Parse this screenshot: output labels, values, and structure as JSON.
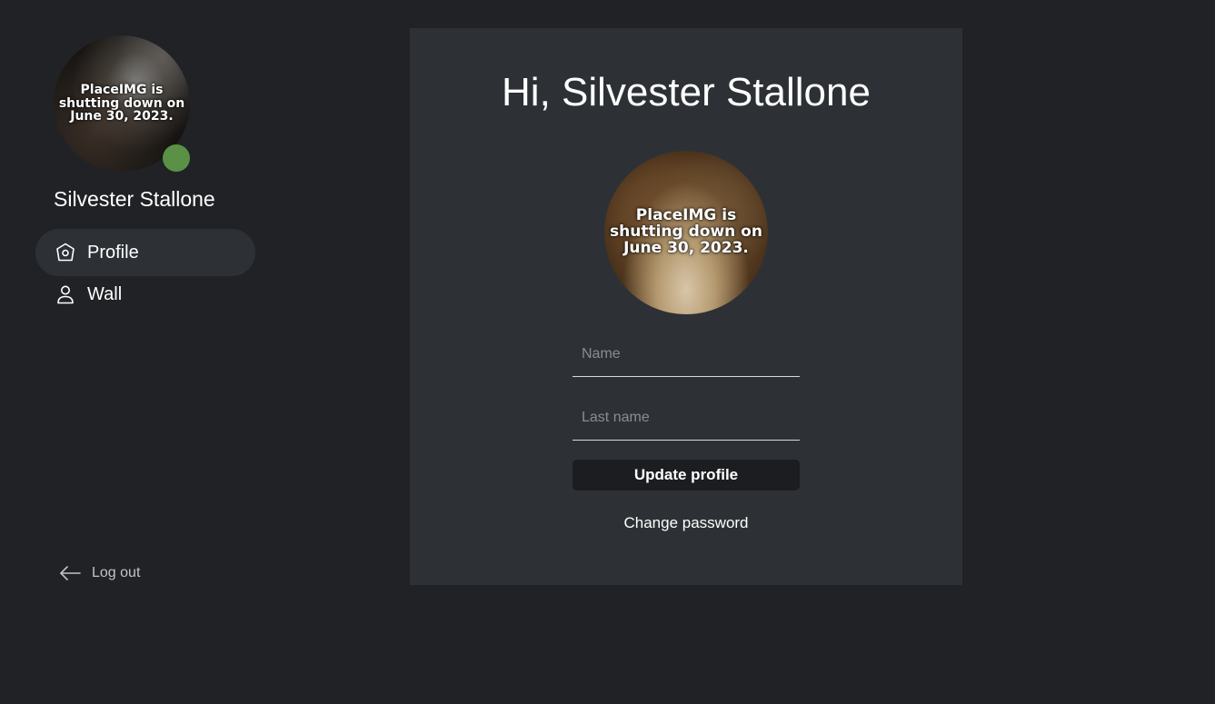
{
  "sidebar": {
    "avatar": {
      "placeholder_text": "PlaceIMG is shutting down on June 30, 2023.",
      "status_color": "#5a9146"
    },
    "user_name": "Silvester Stallone",
    "nav": [
      {
        "label": "Profile",
        "icon": "home-icon",
        "active": true
      },
      {
        "label": "Wall",
        "icon": "user-icon",
        "active": false
      }
    ],
    "logout": {
      "label": "Log out",
      "icon": "arrow-left-icon"
    }
  },
  "main": {
    "greeting": "Hi, Silvester Stallone",
    "avatar": {
      "placeholder_text": "PlaceIMG is shutting down on June 30, 2023."
    },
    "form": {
      "name": {
        "value": "",
        "placeholder": "Name"
      },
      "last_name": {
        "value": "",
        "placeholder": "Last name"
      },
      "update_label": "Update profile",
      "change_password_label": "Change password"
    }
  },
  "colors": {
    "background": "#212226",
    "panel": "#2d3135",
    "button": "#1b1d20",
    "accent_status": "#5a9146"
  }
}
